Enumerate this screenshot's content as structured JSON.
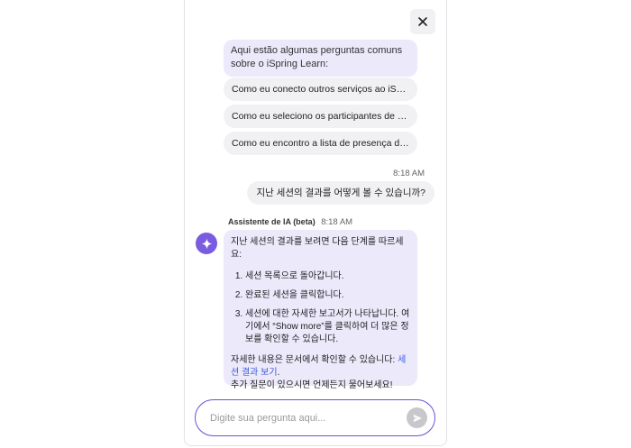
{
  "chat": {
    "intro": "Aqui estão algumas perguntas comuns sobre o iSpring Learn:",
    "suggestions": [
      "Como eu conecto outros serviços ao iSpring Learn?",
      "Como eu seleciono os participantes de uma sessão?",
      "Como eu encontro a lista de presença do evento?"
    ],
    "user_time": "8:18 AM",
    "user_message": "지난 세션의 결과를 어떻게 볼 수 있습니까?",
    "assistant_name": "Assistente de IA (beta)",
    "assistant_time": "8:18 AM",
    "answer": {
      "intro": "지난 세션의 결과를 보려면 다음 단계를 따르세요:",
      "steps": [
        "세션 목록으로 돌아갑니다.",
        "완료된 세션을 클릭합니다.",
        "세션에 대한 자세한 보고서가 나타납니다. 여기에서 “Show more”를 클릭하여 더 많은 정보를 확인할 수 있습니다."
      ],
      "more_prefix": "자세한 내용은 문서에서 확인할 수 있습니다: ",
      "link_text": "세션 결과 보기",
      "period": ".",
      "closing": "추가 질문이 있으시면 언제든지 물어보세요!"
    }
  },
  "input": {
    "placeholder": "Digite sua pergunta aqui..."
  },
  "icons": {
    "close": "close-icon",
    "sparkle": "sparkle-icon",
    "send": "send-icon"
  },
  "colors": {
    "accent": "#6a4fd8",
    "avatar": "#7a5ce0",
    "assistant_bubble": "#ece9fb",
    "link": "#3b5bdb"
  }
}
